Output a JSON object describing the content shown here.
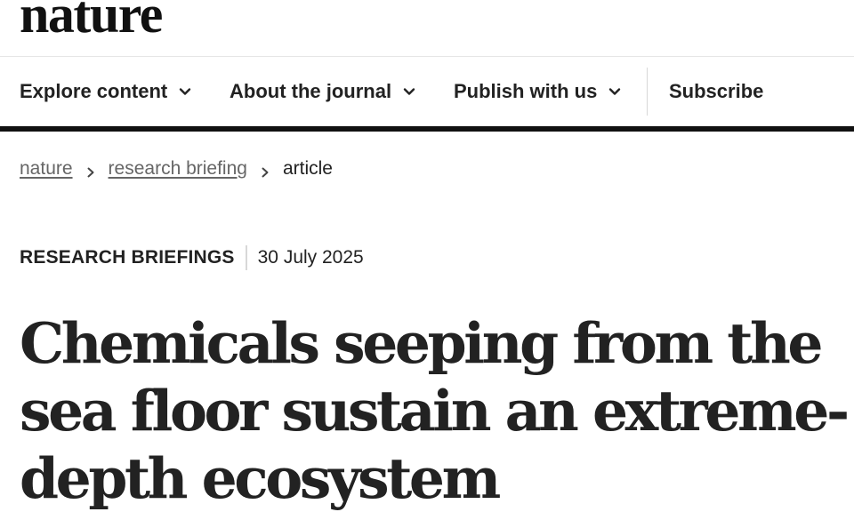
{
  "header": {
    "logo_text": "nature"
  },
  "nav": {
    "items": [
      {
        "label": "Explore content",
        "icon": "chevron-down-icon"
      },
      {
        "label": "About the journal",
        "icon": "chevron-down-icon"
      },
      {
        "label": "Publish with us",
        "icon": "chevron-down-icon"
      }
    ],
    "subscribe_label": "Subscribe"
  },
  "breadcrumb": {
    "items": [
      {
        "label": "nature",
        "link": true
      },
      {
        "label": "research briefing",
        "link": true
      },
      {
        "label": "article",
        "link": false
      }
    ],
    "separator_icon": "chevron-right-icon"
  },
  "article": {
    "type": "RESEARCH BRIEFINGS",
    "date": "30 July 2025",
    "title": "Chemicals seeping from the sea floor sustain an extreme-depth ecosystem"
  },
  "colors": {
    "text": "#222222",
    "muted_link": "#666666",
    "divider": "#d8d8d8",
    "nav_rule": "#111111"
  }
}
